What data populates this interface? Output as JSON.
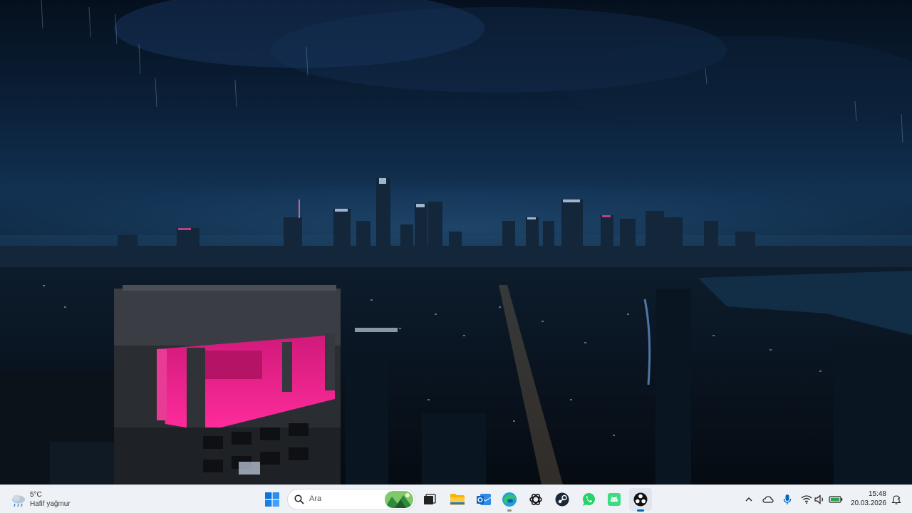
{
  "weather": {
    "temperature": "5°C",
    "condition": "Hafif yağmur",
    "icon": "rain-cloud-icon"
  },
  "taskbar": {
    "start_icon": "windows-start-icon",
    "search_placeholder": "Ara",
    "pinned": [
      {
        "name": "task-view",
        "icon": "task-view-icon"
      },
      {
        "name": "file-explorer",
        "icon": "folder-icon"
      },
      {
        "name": "outlook",
        "icon": "outlook-icon"
      },
      {
        "name": "edge",
        "icon": "edge-icon"
      },
      {
        "name": "chatgpt",
        "icon": "chatgpt-icon"
      },
      {
        "name": "steam",
        "icon": "steam-icon"
      },
      {
        "name": "whatsapp",
        "icon": "whatsapp-icon"
      },
      {
        "name": "android-app",
        "icon": "android-icon"
      },
      {
        "name": "obs",
        "icon": "obs-icon",
        "active": true
      }
    ]
  },
  "tray": {
    "icons": [
      "chevron-up-icon",
      "onedrive-icon",
      "microphone-icon",
      "wifi-icon",
      "volume-icon",
      "battery-icon"
    ],
    "time": "15:48",
    "date": "20.03.2026",
    "notification_icon": "notification-bell-icon"
  },
  "colors": {
    "taskbar_bg": "#eef1f6",
    "accent": "#0067c0",
    "sky_dark": "#05101e",
    "magenta_glow": "#e0157f"
  }
}
